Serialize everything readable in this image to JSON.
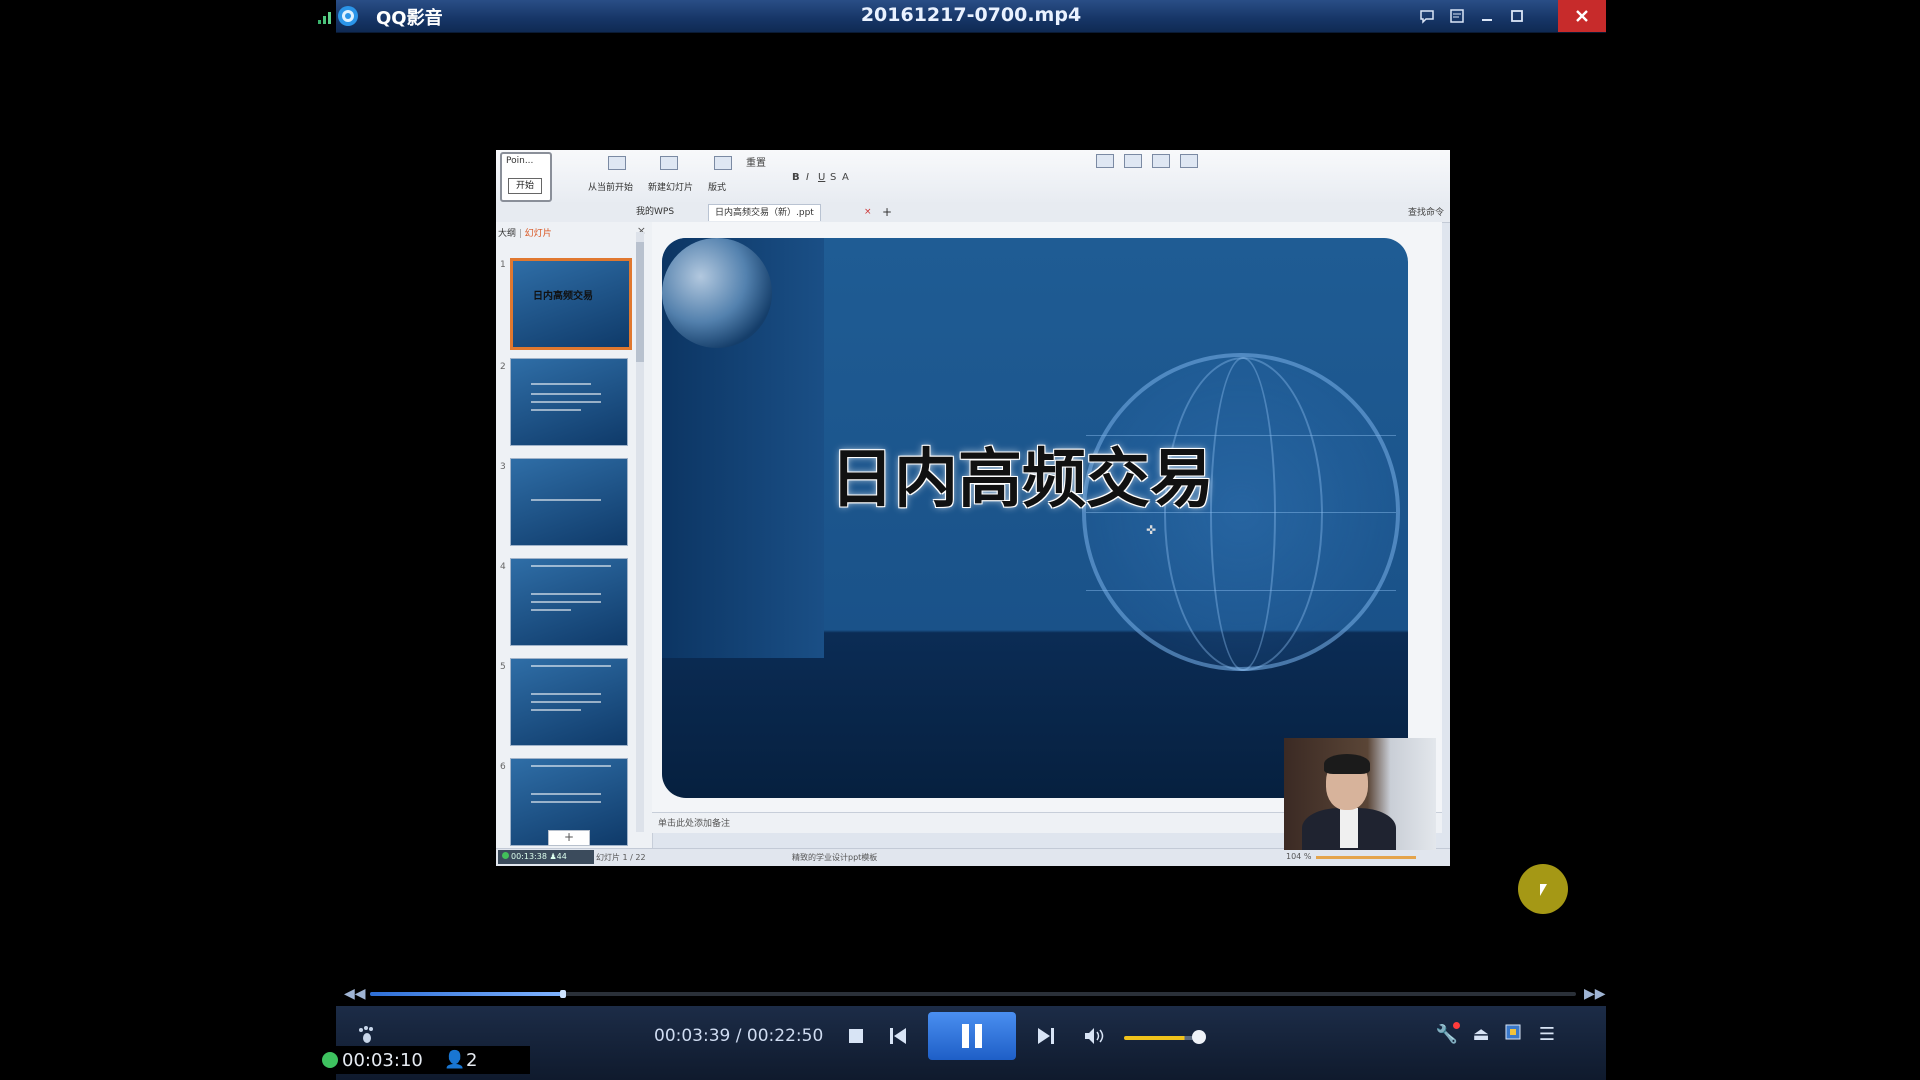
{
  "player": {
    "app_name": "QQ影音",
    "file_title": "20161217-0700.mp4",
    "window_buttons": [
      "chat-icon",
      "playlist-icon",
      "minimize-icon",
      "maximize-icon",
      "close-icon"
    ]
  },
  "wps": {
    "start_top": "Poin...",
    "start_button": "开始",
    "ribbon": {
      "from_current": "从当前开始",
      "new_slide": "新建幻灯片",
      "layout": "版式",
      "reset": "重置"
    },
    "tabs": {
      "my_wps": "我的WPS",
      "document": "日内高频交易（新）.ppt"
    },
    "find_command": "查找命令",
    "thumb_pane_tabs": {
      "outline": "大纲",
      "slides": "幻灯片"
    },
    "slides": [
      {
        "num": "1",
        "title": "日内高频交易"
      },
      {
        "num": "2"
      },
      {
        "num": "3"
      },
      {
        "num": "4"
      },
      {
        "num": "5"
      },
      {
        "num": "6"
      }
    ],
    "main_slide_title": "日内高频交易",
    "notes_placeholder": "单击此处添加备注",
    "status": {
      "recording_time": "00:13:38",
      "recording_users": "44",
      "page": "幻灯片 1 / 22",
      "template": "精致的学业设计ppt模板",
      "zoom": "104 %"
    }
  },
  "playback": {
    "current": "00:03:39",
    "total": "00:22:50",
    "progress": 0.16,
    "volume": 0.82
  },
  "live": {
    "elapsed": "00:03:10",
    "viewers": "2"
  },
  "colors": {
    "title_bar": "#163566",
    "close_button": "#c72b2b",
    "play_button": "#2f74dc",
    "volume": "#f0c21b",
    "live_dot": "#3ec25f"
  }
}
